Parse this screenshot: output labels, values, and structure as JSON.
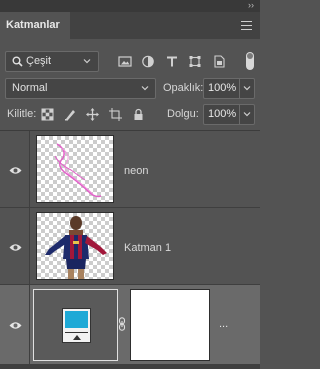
{
  "panel": {
    "tab_label": "Katmanlar"
  },
  "filter": {
    "kind_label": "Çeşit"
  },
  "blend": {
    "mode": "Normal"
  },
  "opacity": {
    "label": "Opaklık:",
    "value": "100%"
  },
  "lock": {
    "label": "Kilitle:"
  },
  "fill": {
    "label": "Dolgu:",
    "value": "100%"
  },
  "layers": [
    {
      "name": "neon",
      "visible": true
    },
    {
      "name": "Katman 1",
      "visible": true
    },
    {
      "name": "",
      "visible": true,
      "selected": true,
      "more": "..."
    }
  ],
  "colors": {
    "panel_bg": "#535353",
    "selected_layer_bg": "#6a6a6a",
    "adjustment_swatch": "#1ea9d6",
    "neon_stroke": "#e25fc8"
  }
}
